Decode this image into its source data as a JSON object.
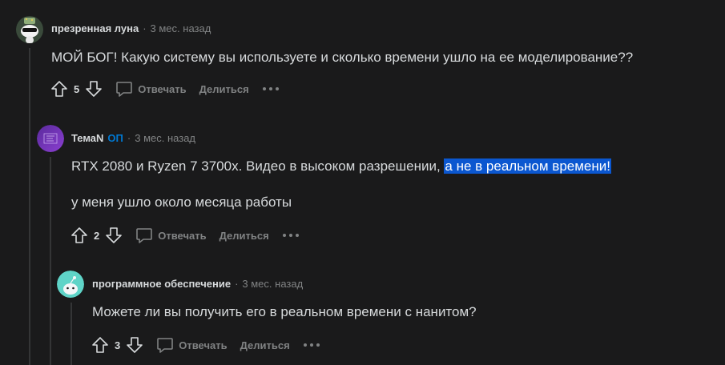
{
  "comments": [
    {
      "author": "презренная луна",
      "op_badge": "",
      "time": "3 мес. назад",
      "body": [
        "МОЙ БОГ! Какую систему вы используете и сколько времени ушло на ее моделирование??"
      ],
      "score": "5",
      "reply_label": "Отвечать",
      "share_label": "Делиться"
    },
    {
      "author": "ТемаN",
      "op_badge": "ОП",
      "time": "3 мес. назад",
      "body_line1_plain": "RTX 2080 и Ryzen 7 3700x. Видео в высоком разрешении, ",
      "body_line1_selected": "а не в реальном времени!",
      "body_line2": "у меня ушло около месяца работы",
      "score": "2",
      "reply_label": "Отвечать",
      "share_label": "Делиться"
    },
    {
      "author": "программное обеспечение",
      "op_badge": "",
      "time": "3 мес. назад",
      "body": [
        "Можете ли вы получить его в реальном времени с нанитом?"
      ],
      "score": "3",
      "reply_label": "Отвечать",
      "share_label": "Делиться"
    }
  ],
  "separator": "·",
  "colors": {
    "background": "#1a1a1b",
    "text": "#d7dadc",
    "muted": "#818384",
    "op_blue": "#0079d3",
    "selection": "#0b57d0",
    "thread_line": "#343536"
  }
}
